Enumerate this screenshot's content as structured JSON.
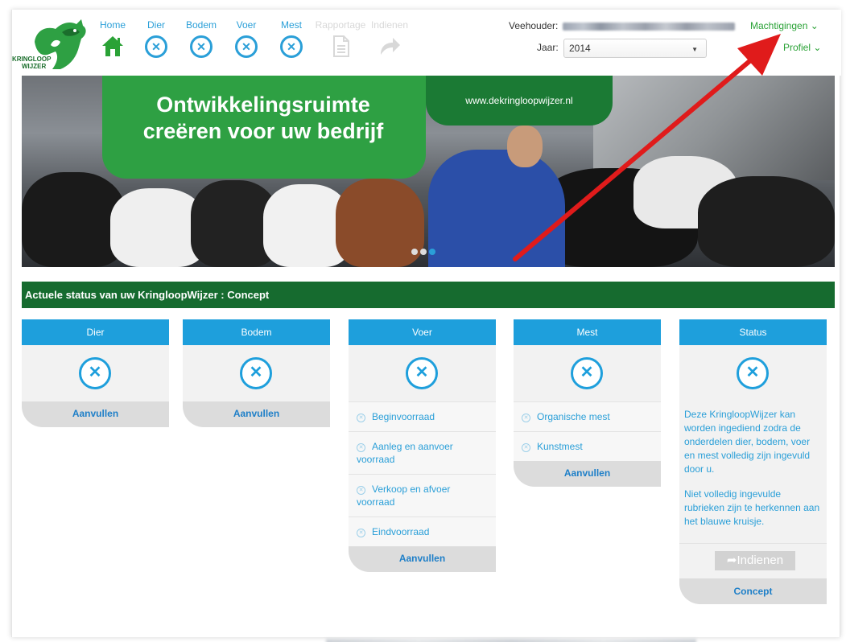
{
  "header": {
    "logo_line1": "KRINGLOOP",
    "logo_line2": "WIJZER",
    "nav": [
      {
        "label": "Home",
        "icon": "home-icon"
      },
      {
        "label": "Dier",
        "icon": "x-circle-icon"
      },
      {
        "label": "Bodem",
        "icon": "x-circle-icon"
      },
      {
        "label": "Voer",
        "icon": "x-circle-icon"
      },
      {
        "label": "Mest",
        "icon": "x-circle-icon"
      },
      {
        "label": "Rapportage",
        "icon": "document-icon"
      },
      {
        "label": "Indienen",
        "icon": "share-arrow-icon"
      }
    ],
    "veehouder_label": "Veehouder:",
    "machtigingen": "Machtigingen",
    "jaar_label": "Jaar:",
    "jaar_value": "2014",
    "profiel": "Profiel"
  },
  "banner": {
    "title_line1": "Ontwikkelingsruimte",
    "title_line2": "creëren voor uw bedrijf",
    "url": "www.dekringloopwijzer.nl"
  },
  "status_bar": "Actuele status van uw KringloopWijzer : Concept",
  "cards": {
    "dier": {
      "title": "Dier",
      "foot": "Aanvullen"
    },
    "bodem": {
      "title": "Bodem",
      "foot": "Aanvullen"
    },
    "voer": {
      "title": "Voer",
      "items": [
        "Beginvoorraad",
        "Aanleg en aanvoer voorraad",
        "Verkoop en afvoer voorraad",
        "Eindvoorraad"
      ],
      "foot": "Aanvullen"
    },
    "mest": {
      "title": "Mest",
      "items": [
        "Organische mest",
        "Kunstmest"
      ],
      "foot": "Aanvullen"
    },
    "status": {
      "title": "Status",
      "text1": "Deze KringloopWijzer kan worden ingediend zodra de onderdelen dier, bodem, voer en mest volledig zijn ingevuld door u.",
      "text2": "Niet volledig ingevulde rubrieken zijn te herkennen aan het blauwe kruisje.",
      "indienen": "Indienen",
      "foot": "Concept"
    }
  },
  "colors": {
    "brand_green": "#2ea043",
    "dark_green": "#166b2f",
    "accent_blue": "#1e9fdc",
    "arrow_red": "#e01b1b"
  }
}
